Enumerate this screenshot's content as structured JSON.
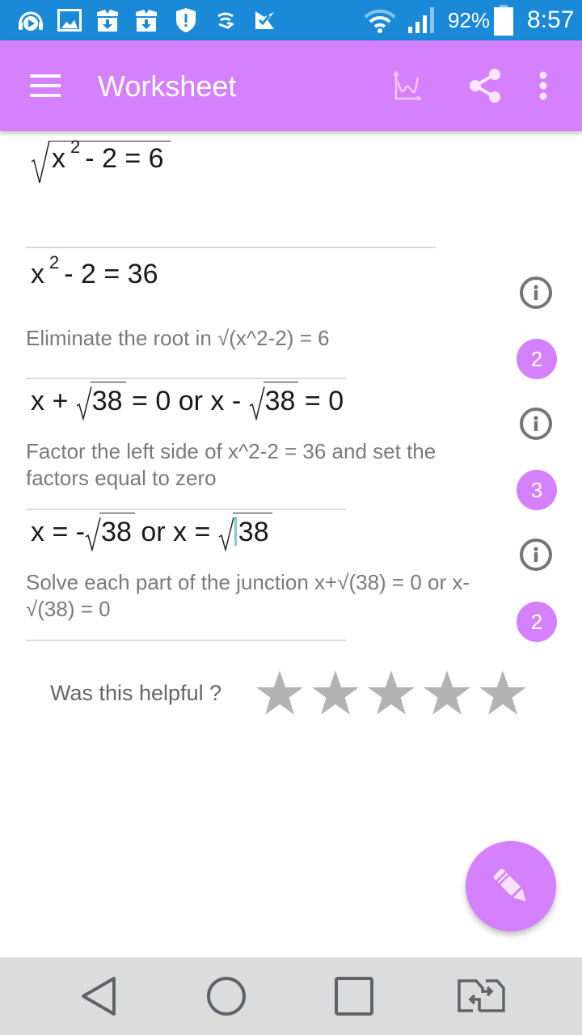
{
  "status_bar": {
    "notification_icons": [
      "headphones-play-icon",
      "image-icon",
      "download-box-icon",
      "download-box-icon",
      "shield-alert-icon",
      "wireless-hand-icon",
      "check-flag-icon"
    ],
    "battery_percent": "92%",
    "time": "8:57"
  },
  "app_bar": {
    "title": "Worksheet",
    "actions": [
      "graph-icon",
      "share-icon",
      "more-vert-icon"
    ]
  },
  "worksheet": {
    "steps": [
      {
        "equation_parts": {
          "radicand_base": "x",
          "exponent": "2",
          "rest": "- 2 = 6"
        },
        "equation_text": "√(x^2 - 2) = 6"
      },
      {
        "equation_parts": {
          "base": "x",
          "exponent": "2",
          "rest": "- 2 = 36"
        },
        "equation_text": "x^2 - 2 = 36",
        "explanation": "Eliminate the root in √(x^2-2) = 6",
        "badge": "2"
      },
      {
        "equation_parts": {
          "p1": "x +",
          "r1": "38",
          "p2": "= 0 or x -",
          "r2": "38",
          "p3": "= 0"
        },
        "equation_text": "x + √38 = 0 or x - √38 = 0",
        "explanation": "Factor the left side of x^2-2 = 36 and set the factors equal to zero",
        "badge": "3"
      },
      {
        "equation_parts": {
          "p1": "x = -",
          "r1": "38",
          "p2": "or x =",
          "r2": "38"
        },
        "equation_text": "x = -√38 or x = √38",
        "explanation": "Solve each part of the junction x+√(38) = 0 or x-√(38) = 0",
        "badge": "2"
      }
    ]
  },
  "feedback": {
    "label": "Was this helpful ?",
    "max_stars": 5,
    "rating": 0
  },
  "fab": {
    "icon": "pencil-icon"
  },
  "nav_bar": {
    "buttons": [
      "back",
      "home",
      "recents",
      "switch-apps"
    ]
  },
  "colors": {
    "status_bar": "#1a8ad8",
    "accent": "#d580fc",
    "star_empty": "#b3b3b3",
    "explanation_text": "#7a7a7a",
    "nav_bar": "#dcdcdc"
  }
}
